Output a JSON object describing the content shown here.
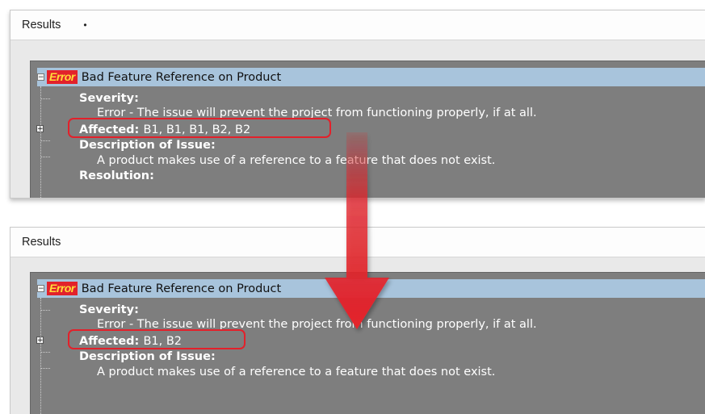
{
  "top_panel": {
    "header_title": "Results",
    "header_dot": "•",
    "issue": {
      "badge": "Error",
      "title": "Bad Feature Reference on Product",
      "severity_label": "Severity:",
      "severity_value": "Error - The issue will prevent the project from functioning properly, if at all.",
      "affected_label": "Affected:",
      "affected_value": "B1, B1, B1, B2, B2",
      "description_label": "Description of Issue:",
      "description_value": "A product makes use of a reference to a feature that does not exist.",
      "resolution_label": "Resolution:"
    }
  },
  "bottom_panel": {
    "header_title": "Results",
    "issue": {
      "badge": "Error",
      "title": "Bad Feature Reference on Product",
      "severity_label": "Severity:",
      "severity_value": "Error - The issue will prevent the project from functioning properly, if at all.",
      "affected_label": "Affected:",
      "affected_value": "B1, B2",
      "description_label": "Description of Issue:",
      "description_value": "A product makes use of a reference to a feature that does not exist."
    }
  },
  "colors": {
    "badge_bg": "#e2222b",
    "badge_text": "#ffdc3a",
    "selection_bg": "#a8c4dc",
    "tree_bg": "#7e7e7e",
    "highlight": "#e3202a"
  }
}
